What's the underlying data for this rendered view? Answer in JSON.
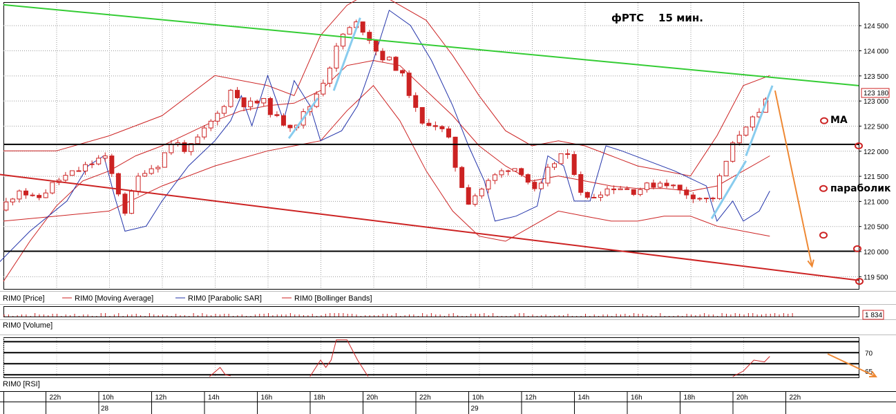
{
  "chart_data": {
    "type": "candlestick",
    "title": "фРТС    15 мин.",
    "price_panel": {
      "ylim": [
        119250,
        124950
      ],
      "y_ticks": [
        119500,
        120000,
        120500,
        121000,
        121500,
        122000,
        122500,
        123000,
        123500,
        124000,
        124500
      ],
      "last_price": "123 180",
      "legend": [
        "RIM0 [Price]",
        "RIM0 [Moving Average]",
        "RIM0 [Parabolic SAR]",
        "RIM0 [Bollinger Bands]"
      ],
      "horizontal_levels": [
        122130,
        120000
      ],
      "trendlines": [
        {
          "name": "upper-channel",
          "color": "#33cc33",
          "from": [
            0.0,
            124910
          ],
          "to": [
            1.0,
            123300
          ]
        },
        {
          "name": "lower-channel",
          "color": "#cc2222",
          "from": [
            -0.3,
            122150
          ],
          "to": [
            1.0,
            119420
          ]
        }
      ],
      "close_path": [
        [
          0.0,
          120900
        ],
        [
          0.3,
          121250
        ],
        [
          0.6,
          121000
        ],
        [
          1.0,
          121400
        ],
        [
          1.5,
          121650
        ],
        [
          1.9,
          121900
        ],
        [
          2.1,
          121400
        ],
        [
          2.3,
          120800
        ],
        [
          2.6,
          121600
        ],
        [
          2.9,
          121700
        ],
        [
          3.2,
          122200
        ],
        [
          3.5,
          122000
        ],
        [
          3.8,
          122400
        ],
        [
          4.1,
          122800
        ],
        [
          4.3,
          123200
        ],
        [
          4.6,
          122900
        ],
        [
          4.9,
          123000
        ],
        [
          5.2,
          122600
        ],
        [
          5.5,
          122500
        ],
        [
          5.8,
          122900
        ],
        [
          6.1,
          123500
        ],
        [
          6.4,
          124300
        ],
        [
          6.7,
          124550
        ],
        [
          6.9,
          124300
        ],
        [
          7.1,
          123900
        ],
        [
          7.3,
          123800
        ],
        [
          7.5,
          123600
        ],
        [
          7.7,
          123100
        ],
        [
          7.9,
          122500
        ],
        [
          8.1,
          122600
        ],
        [
          8.4,
          122300
        ],
        [
          8.6,
          121500
        ],
        [
          8.8,
          121000
        ],
        [
          9.0,
          121200
        ],
        [
          9.3,
          121500
        ],
        [
          9.6,
          121700
        ],
        [
          9.8,
          121600
        ],
        [
          10.1,
          121100
        ],
        [
          10.3,
          121600
        ],
        [
          10.6,
          122000
        ],
        [
          10.8,
          121600
        ],
        [
          11.0,
          121000
        ],
        [
          11.3,
          121200
        ],
        [
          11.6,
          121300
        ],
        [
          11.9,
          121200
        ],
        [
          12.2,
          121300
        ],
        [
          12.5,
          121400
        ],
        [
          12.8,
          121200
        ],
        [
          13.1,
          121100
        ],
        [
          13.4,
          121000
        ],
        [
          13.6,
          121600
        ],
        [
          13.8,
          122100
        ],
        [
          14.0,
          122500
        ],
        [
          14.3,
          122700
        ],
        [
          14.5,
          123180
        ]
      ],
      "moving_average": [
        [
          0.0,
          119400
        ],
        [
          0.5,
          120200
        ],
        [
          1.0,
          120900
        ],
        [
          1.5,
          121400
        ],
        [
          2.0,
          121600
        ],
        [
          2.5,
          121900
        ],
        [
          3.0,
          122100
        ],
        [
          3.5,
          122350
        ],
        [
          4.0,
          122600
        ],
        [
          4.5,
          122800
        ],
        [
          5.0,
          122900
        ],
        [
          5.5,
          122950
        ],
        [
          6.0,
          123200
        ],
        [
          6.5,
          123700
        ],
        [
          7.0,
          123800
        ],
        [
          7.5,
          123700
        ],
        [
          8.0,
          123200
        ],
        [
          8.5,
          122700
        ],
        [
          9.0,
          122100
        ],
        [
          9.5,
          121700
        ],
        [
          10.0,
          121400
        ],
        [
          10.5,
          121500
        ],
        [
          11.0,
          121400
        ],
        [
          11.5,
          121300
        ],
        [
          12.0,
          121250
        ],
        [
          12.5,
          121250
        ],
        [
          13.0,
          121200
        ],
        [
          13.5,
          121300
        ],
        [
          14.0,
          121600
        ],
        [
          14.5,
          121900
        ]
      ],
      "bollinger_upper": [
        [
          0.0,
          122000
        ],
        [
          1.0,
          122000
        ],
        [
          2.0,
          122300
        ],
        [
          3.0,
          122700
        ],
        [
          4.0,
          123500
        ],
        [
          5.0,
          123300
        ],
        [
          5.5,
          123100
        ],
        [
          6.0,
          124300
        ],
        [
          6.5,
          124900
        ],
        [
          7.0,
          125200
        ],
        [
          7.5,
          124900
        ],
        [
          8.0,
          124600
        ],
        [
          8.5,
          123900
        ],
        [
          9.0,
          123100
        ],
        [
          9.5,
          122400
        ],
        [
          10.0,
          122100
        ],
        [
          10.5,
          122200
        ],
        [
          11.0,
          122100
        ],
        [
          11.5,
          121900
        ],
        [
          12.0,
          121700
        ],
        [
          12.5,
          121600
        ],
        [
          13.0,
          121500
        ],
        [
          13.5,
          122300
        ],
        [
          14.0,
          123300
        ],
        [
          14.5,
          123500
        ]
      ],
      "bollinger_lower": [
        [
          0.0,
          120600
        ],
        [
          1.0,
          120700
        ],
        [
          2.0,
          120800
        ],
        [
          3.0,
          121300
        ],
        [
          4.0,
          121700
        ],
        [
          5.0,
          122000
        ],
        [
          5.5,
          122100
        ],
        [
          6.0,
          122200
        ],
        [
          6.5,
          122800
        ],
        [
          7.0,
          123300
        ],
        [
          7.5,
          122600
        ],
        [
          8.0,
          121600
        ],
        [
          8.5,
          120800
        ],
        [
          9.0,
          120300
        ],
        [
          9.5,
          120200
        ],
        [
          10.0,
          120500
        ],
        [
          10.5,
          120800
        ],
        [
          11.0,
          120700
        ],
        [
          11.5,
          120600
        ],
        [
          12.0,
          120600
        ],
        [
          12.5,
          120700
        ],
        [
          13.0,
          120700
        ],
        [
          13.5,
          120500
        ],
        [
          14.0,
          120400
        ],
        [
          14.5,
          120300
        ]
      ],
      "parabolic_sar": [
        [
          -0.2,
          119650
        ],
        [
          0.5,
          120400
        ],
        [
          1.2,
          121000
        ],
        [
          1.6,
          121700
        ],
        [
          1.9,
          121900
        ],
        [
          2.1,
          121100
        ],
        [
          2.3,
          120400
        ],
        [
          2.7,
          120500
        ],
        [
          3.0,
          121000
        ],
        [
          3.5,
          121700
        ],
        [
          4.0,
          122200
        ],
        [
          4.3,
          122600
        ],
        [
          4.5,
          123100
        ],
        [
          4.7,
          122500
        ],
        [
          5.0,
          123500
        ],
        [
          5.3,
          122600
        ],
        [
          5.5,
          123400
        ],
        [
          5.8,
          122900
        ],
        [
          6.0,
          122200
        ],
        [
          6.4,
          122400
        ],
        [
          6.7,
          122900
        ],
        [
          7.0,
          123800
        ],
        [
          7.3,
          124800
        ],
        [
          7.7,
          124500
        ],
        [
          8.1,
          123800
        ],
        [
          8.5,
          122900
        ],
        [
          8.8,
          122100
        ],
        [
          9.1,
          121400
        ],
        [
          9.3,
          120600
        ],
        [
          9.7,
          120700
        ],
        [
          10.1,
          120900
        ],
        [
          10.3,
          121900
        ],
        [
          10.6,
          121700
        ],
        [
          10.8,
          121000
        ],
        [
          11.1,
          121000
        ],
        [
          11.4,
          122100
        ],
        [
          11.7,
          122000
        ],
        [
          12.2,
          121800
        ],
        [
          12.7,
          121600
        ],
        [
          13.3,
          121300
        ],
        [
          13.5,
          120600
        ],
        [
          13.8,
          121000
        ],
        [
          14.0,
          120600
        ],
        [
          14.3,
          120800
        ],
        [
          14.5,
          121200
        ]
      ]
    },
    "volume_panel": {
      "legend": "RIM0 [Volume]",
      "last_value": "1 834"
    },
    "rsi_panel": {
      "legend": "RIM0 [RSI]",
      "y_ticks": [
        70,
        65
      ],
      "levels": [
        73,
        70,
        67,
        64
      ],
      "rsi_segments": [
        [
          [
            3.9,
            63.5
          ],
          [
            4.1,
            66
          ],
          [
            4.2,
            64
          ],
          [
            4.3,
            63.7
          ]
        ],
        [
          [
            5.8,
            63.5
          ],
          [
            6.0,
            68
          ],
          [
            6.1,
            66
          ],
          [
            6.2,
            68
          ],
          [
            6.3,
            73.5
          ],
          [
            6.5,
            73.5
          ],
          [
            6.7,
            68
          ],
          [
            6.9,
            63.5
          ]
        ],
        [
          [
            13.8,
            63.5
          ],
          [
            14.0,
            65
          ],
          [
            14.2,
            68
          ],
          [
            14.4,
            67.5
          ],
          [
            14.5,
            69
          ]
        ]
      ]
    },
    "x_axis": {
      "ticks": [
        "22h",
        "10h",
        "12h",
        "14h",
        "16h",
        "18h",
        "20h",
        "22h",
        "10h",
        "12h",
        "14h",
        "16h",
        "18h",
        "20h",
        "22h"
      ],
      "dates": [
        {
          "at": 1,
          "label": "28"
        },
        {
          "at": 8,
          "label": "29"
        }
      ]
    },
    "annotations": [
      {
        "text": "МА",
        "price": 122620
      },
      {
        "text": "параболик",
        "price": 121250
      }
    ],
    "marker_prices": [
      122600,
      121250,
      120320,
      122100,
      120050,
      119400
    ],
    "forecast_arrow": {
      "from": [
        14.6,
        123200
      ],
      "to": [
        15.3,
        119700
      ]
    }
  }
}
